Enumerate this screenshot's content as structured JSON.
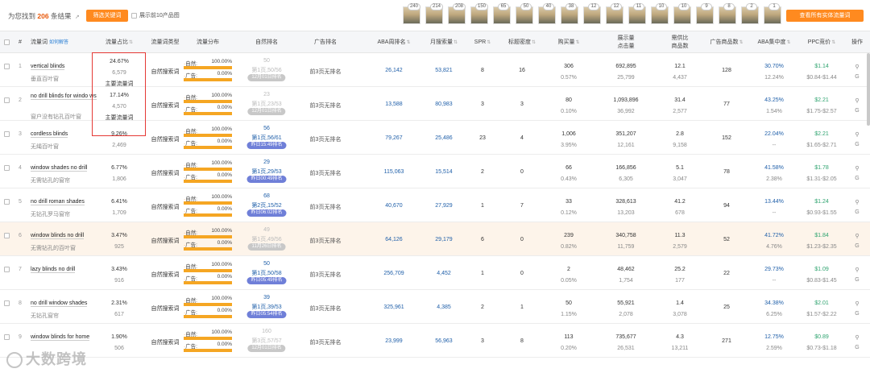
{
  "topbar": {
    "prefix": "为您找到",
    "count": "206",
    "suffix": "条结果",
    "ext_icon": "↗",
    "filter_button": "筛选关键词",
    "top10_label": "展示前10产品图",
    "view_all_button": "查看所有实体流量词",
    "thumb_badges": [
      "240",
      "214",
      "208",
      "150",
      "65",
      "50",
      "40",
      "38",
      "12",
      "12",
      "11",
      "10",
      "10",
      "9",
      "8",
      "2",
      "1"
    ]
  },
  "columns": {
    "num": "#",
    "keyword": "流量词",
    "keyword_extra": "如何解答",
    "share": "流量占比",
    "type": "流量词类型",
    "dist": "流量分布",
    "organic": "自然排名",
    "ad": "广告排名",
    "aba": "ABA周排名",
    "monthly": "月搜索量",
    "spr": "SPR",
    "title_density": "标题密度",
    "purchase": "购买量",
    "impressions": "展示量",
    "impressions_sub": "点击量",
    "demand": "需供比",
    "demand_sub": "商品数",
    "ad_products": "广告商品数",
    "aba_ctr": "ABA集中度",
    "ppc": "PPC竞价",
    "ops": "操作"
  },
  "labels": {
    "organic_type": "自然搜索词",
    "organic_dist": "自然:",
    "ad_dist": "广告:",
    "ad_rank_none": "前3页无排名",
    "main_flow": "主要流量词",
    "op1": "⚲",
    "op2": "G"
  },
  "rows": [
    {
      "num": "1",
      "kw": "vertical blinds",
      "kw_cn": "垂直百叶窗",
      "share": "24.67%",
      "share_sub": "6,579",
      "main": "主要流量词",
      "d_org": "100.00%",
      "d_ad": "0.00%",
      "r0": "50",
      "r1": "第1页,50/56",
      "pill": "12月01日排名",
      "on": false,
      "aba": "26,142",
      "monthly": "53,821",
      "spr": "8",
      "td": "16",
      "buy": "306",
      "buy_sub": "0.57%",
      "imp": "692,895",
      "imp_sub": "25,799",
      "dem": "12.1",
      "dem_sub": "4,437",
      "adp": "128",
      "abac": "30.70%",
      "abac_sub": "12.24%",
      "ppc": "$1.14",
      "ppc_sub": "$0.84-$1.44"
    },
    {
      "num": "2",
      "kw": "no drill blinds for windo ws",
      "kw_cn": "窗户没有钻孔百叶窗",
      "share": "17.14%",
      "share_sub": "4,570",
      "main": "主要流量词",
      "d_org": "100.00%",
      "d_ad": "0.00%",
      "r0": "23",
      "r1": "第1页,23/53",
      "pill": "12月01日排名",
      "on": false,
      "aba": "13,588",
      "monthly": "80,983",
      "spr": "3",
      "td": "3",
      "buy": "80",
      "buy_sub": "0.10%",
      "imp": "1,093,896",
      "imp_sub": "36,992",
      "dem": "31.4",
      "dem_sub": "2,577",
      "adp": "77",
      "abac": "43.25%",
      "abac_sub": "1.54%",
      "ppc": "$2.21",
      "ppc_sub": "$1.75-$2.57"
    },
    {
      "num": "3",
      "kw": "cordless blinds",
      "kw_cn": "无绳百叶窗",
      "share": "9.26%",
      "share_sub": "2,469",
      "main": "",
      "d_org": "100.00%",
      "d_ad": "0.00%",
      "r0": "56",
      "r1": "第1页,56/61",
      "pill": "昨日15:49排名",
      "on": true,
      "aba": "79,267",
      "monthly": "25,486",
      "spr": "23",
      "td": "4",
      "buy": "1,006",
      "buy_sub": "3.95%",
      "imp": "351,207",
      "imp_sub": "12,161",
      "dem": "2.8",
      "dem_sub": "9,158",
      "adp": "152",
      "abac": "22.04%",
      "abac_sub": "--",
      "ppc": "$2.21",
      "ppc_sub": "$1.65-$2.71"
    },
    {
      "num": "4",
      "kw": "window shades no drill",
      "kw_cn": "无需钻孔的窗帘",
      "share": "6.77%",
      "share_sub": "1,806",
      "main": "",
      "d_org": "100.00%",
      "d_ad": "0.00%",
      "r0": "29",
      "r1": "第1页,29/53",
      "pill": "昨日00:49排名",
      "on": true,
      "aba": "115,063",
      "monthly": "15,514",
      "spr": "2",
      "td": "0",
      "buy": "66",
      "buy_sub": "0.43%",
      "imp": "166,856",
      "imp_sub": "6,305",
      "dem": "5.1",
      "dem_sub": "3,047",
      "adp": "78",
      "abac": "41.58%",
      "abac_sub": "2.38%",
      "ppc": "$1.78",
      "ppc_sub": "$1.31-$2.05"
    },
    {
      "num": "5",
      "kw": "no drill roman shades",
      "kw_cn": "无钻孔罗马窗帘",
      "share": "6.41%",
      "share_sub": "1,709",
      "main": "",
      "d_org": "100.00%",
      "d_ad": "0.00%",
      "r0": "68",
      "r1": "第2页,15/52",
      "pill": "昨日06:02排名",
      "on": true,
      "aba": "40,670",
      "monthly": "27,929",
      "spr": "1",
      "td": "7",
      "buy": "33",
      "buy_sub": "0.12%",
      "imp": "328,613",
      "imp_sub": "13,203",
      "dem": "41.2",
      "dem_sub": "678",
      "adp": "94",
      "abac": "13.44%",
      "abac_sub": "--",
      "ppc": "$1.24",
      "ppc_sub": "$0.93-$1.55"
    },
    {
      "num": "6",
      "kw": "window blinds no drill",
      "kw_cn": "无需钻孔的百叶窗",
      "share": "3.47%",
      "share_sub": "925",
      "main": "",
      "d_org": "100.00%",
      "d_ad": "0.00%",
      "r0": "49",
      "r1": "第1页,49/56",
      "pill": "11月26日排名",
      "on": false,
      "aba": "64,126",
      "monthly": "29,179",
      "spr": "6",
      "td": "0",
      "buy": "239",
      "buy_sub": "0.82%",
      "imp": "340,758",
      "imp_sub": "11,759",
      "dem": "11.3",
      "dem_sub": "2,579",
      "adp": "52",
      "abac": "41.72%",
      "abac_sub": "4.76%",
      "ppc": "$1.84",
      "ppc_sub": "$1.23-$2.35"
    },
    {
      "num": "7",
      "kw": "lazy blinds no drill",
      "kw_cn": "",
      "share": "3.43%",
      "share_sub": "916",
      "main": "",
      "d_org": "100.00%",
      "d_ad": "0.00%",
      "r0": "50",
      "r1": "第1页,50/58",
      "pill": "昨日05:49排名",
      "on": true,
      "aba": "256,709",
      "monthly": "4,452",
      "spr": "1",
      "td": "0",
      "buy": "2",
      "buy_sub": "0.05%",
      "imp": "48,462",
      "imp_sub": "1,754",
      "dem": "25.2",
      "dem_sub": "177",
      "adp": "22",
      "abac": "29.73%",
      "abac_sub": "--",
      "ppc": "$1.09",
      "ppc_sub": "$0.83-$1.45"
    },
    {
      "num": "8",
      "kw": "no drill window shades",
      "kw_cn": "无钻孔窗帘",
      "share": "2.31%",
      "share_sub": "617",
      "main": "",
      "d_org": "100.00%",
      "d_ad": "0.00%",
      "r0": "39",
      "r1": "第1页,39/53",
      "pill": "昨日05:54排名",
      "on": true,
      "aba": "325,961",
      "monthly": "4,385",
      "spr": "2",
      "td": "1",
      "buy": "50",
      "buy_sub": "1.15%",
      "imp": "55,921",
      "imp_sub": "2,078",
      "dem": "1.4",
      "dem_sub": "3,078",
      "adp": "25",
      "abac": "34.38%",
      "abac_sub": "6.25%",
      "ppc": "$2.01",
      "ppc_sub": "$1.57-$2.22"
    },
    {
      "num": "9",
      "kw": "window blinds for home",
      "kw_cn": "",
      "share": "1.90%",
      "share_sub": "506",
      "main": "",
      "d_org": "100.00%",
      "d_ad": "0.00%",
      "r0": "160",
      "r1": "第3页,57/57",
      "pill": "12月01日排名",
      "on": false,
      "aba": "23,999",
      "monthly": "56,963",
      "spr": "3",
      "td": "8",
      "buy": "113",
      "buy_sub": "0.20%",
      "imp": "735,677",
      "imp_sub": "26,531",
      "dem": "4.3",
      "dem_sub": "13,211",
      "adp": "271",
      "abac": "12.75%",
      "abac_sub": "2.59%",
      "ppc": "$0.89",
      "ppc_sub": "$0.73-$1.18"
    }
  ],
  "watermark": "大数跨境",
  "colors": {
    "accent": "#ff8a1f",
    "link_blue": "#1f5fa9",
    "green": "#2ea36f",
    "highlight": "#e53935"
  }
}
